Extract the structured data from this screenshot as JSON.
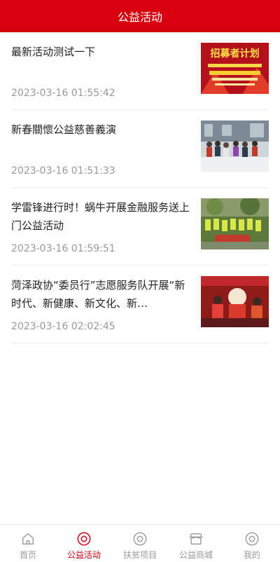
{
  "header": {
    "title": "公益活动"
  },
  "items": [
    {
      "title": "最新活动测试一下",
      "time": "2023-03-16 01:55:42",
      "thumb_text": "招募者计划"
    },
    {
      "title": "新春關懷公益慈善義演",
      "time": "2023-03-16 01:51:33"
    },
    {
      "title": "学雷锋进行时！蜗牛开展金融服务送上门公益活动",
      "time": "2023-03-16 01:59:51"
    },
    {
      "title": "菏泽政协“委员行”志愿服务队开展“新时代、新健康、新文化、新…",
      "time": "2023-03-16 02:02:45"
    }
  ],
  "tabbar": {
    "tabs": [
      {
        "label": "首页",
        "icon": "home-icon"
      },
      {
        "label": "公益活动",
        "icon": "target-icon",
        "active": true
      },
      {
        "label": "扶贫项目",
        "icon": "target-icon"
      },
      {
        "label": "公益商城",
        "icon": "store-icon"
      },
      {
        "label": "我的",
        "icon": "target-icon"
      }
    ]
  },
  "colors": {
    "brand": "#d7000f",
    "inactive": "#999999",
    "time": "#999999"
  }
}
